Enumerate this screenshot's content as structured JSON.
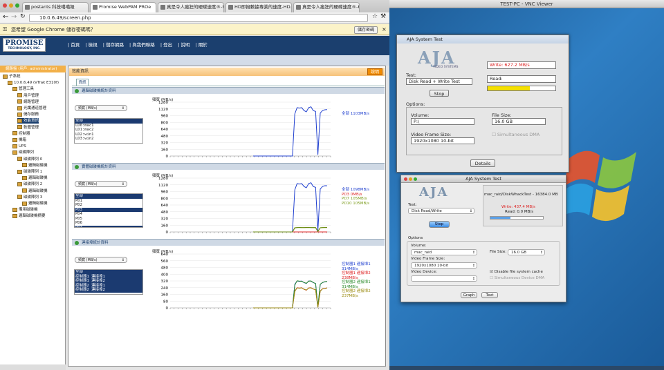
{
  "vnc": {
    "title": "TEST-PC - VNC Viewer"
  },
  "browser": {
    "tabs": [
      "postants 科技噶噶報",
      "Promise WebPAM PROe",
      "真是令人瘋狂的硬碟速度®-Pos",
      "HD即撥數據專業的速度-HD.Club",
      "真是令人瘋狂的硬碟速度®-HD"
    ],
    "url": "10.0.6.49/screen.php",
    "infobar_text": "您希望 Google Chrome 儲存密碼嗎？",
    "infobar_button": "儲存密碼"
  },
  "promise": {
    "logo": "PROMISE",
    "logo_sub": "TECHNOLOGY, INC.",
    "menu": [
      "| 首頁",
      "| 檢視",
      "| 儲存網路",
      "| 與我們聯絡",
      "| 登出",
      "| 說明",
      "| 關於"
    ],
    "sidebar_top": "網路盤 (用戶: administrator)",
    "tree": [
      {
        "label": "子系統",
        "indent": 0
      },
      {
        "label": "10.0.6.49 (VTrak E310f)",
        "indent": 1
      },
      {
        "label": "管理工具",
        "indent": 2
      },
      {
        "label": "用戶管理",
        "indent": 3
      },
      {
        "label": "網路管理",
        "indent": 3
      },
      {
        "label": "光纖通道管理",
        "indent": 3
      },
      {
        "label": "儲存服務",
        "indent": 3
      },
      {
        "label": "效能資訊",
        "indent": 3,
        "selected": true
      },
      {
        "label": "軟體管理",
        "indent": 3
      },
      {
        "label": "控制器",
        "indent": 2
      },
      {
        "label": "機箱",
        "indent": 2
      },
      {
        "label": "UPS",
        "indent": 2
      },
      {
        "label": "磁碟陣列",
        "indent": 2
      },
      {
        "label": "磁碟陣列 0",
        "indent": 3
      },
      {
        "label": "邏輯磁碟機",
        "indent": 4
      },
      {
        "label": "磁碟陣列 1",
        "indent": 3
      },
      {
        "label": "邏輯磁碟機",
        "indent": 4
      },
      {
        "label": "磁碟陣列 2",
        "indent": 3
      },
      {
        "label": "邏輯磁碟機",
        "indent": 4
      },
      {
        "label": "磁碟陣列 3",
        "indent": 3
      },
      {
        "label": "邏輯磁碟機",
        "indent": 4
      },
      {
        "label": "備用磁碟機",
        "indent": 2
      },
      {
        "label": "邏輯磁碟機摘要",
        "indent": 2
      }
    ],
    "page_title": "效能資訊",
    "help_button": "說明",
    "tab_info": "資訊",
    "sections": [
      {
        "title": "邏輯磁碟機統計資料",
        "dropdown": "頻寬 (MB/s)",
        "items": [
          {
            "t": "全部",
            "on": true
          },
          {
            "t": "LD0:mac1",
            "on": false
          },
          {
            "t": "LD1:mac2",
            "on": false
          },
          {
            "t": "LD2:win1",
            "on": false
          },
          {
            "t": "LD3:win2",
            "on": false
          }
        ],
        "chart_title": "頻寬 (MB/s)",
        "legend": [
          {
            "t": "全部 1103MB/s",
            "c": "#1f3fcf"
          }
        ]
      },
      {
        "title": "實體磁碟機統計資料",
        "dropdown": "頻寬 (MB/s)",
        "items": [
          {
            "t": "全部",
            "on": true
          },
          {
            "t": "PD1",
            "on": false
          },
          {
            "t": "PD2",
            "on": false
          },
          {
            "t": "PD3",
            "on": true
          },
          {
            "t": "PD4",
            "on": false
          },
          {
            "t": "PD5",
            "on": false
          },
          {
            "t": "PD6",
            "on": false
          },
          {
            "t": "PD7",
            "on": true
          }
        ],
        "chart_title": "頻寬 (MB/s)",
        "legend": [
          {
            "t": "全部 1098MB/s",
            "c": "#1f3fcf"
          },
          {
            "t": "PD3 0MB/s",
            "c": "#d22"
          },
          {
            "t": "PD7 105MB/s",
            "c": "#7a9a1a"
          },
          {
            "t": "PD10 105MB/s",
            "c": "#7a9a1a"
          }
        ]
      },
      {
        "title": "連接埠統計資料",
        "dropdown": "頻寬 (MB/s)",
        "items": [
          {
            "t": "全部",
            "on": true
          },
          {
            "t": "控制器1 連接埠1",
            "on": true
          },
          {
            "t": "控制器1 連接埠2",
            "on": true
          },
          {
            "t": "控制器2 連接埠1",
            "on": true
          },
          {
            "t": "控制器2 連接埠2",
            "on": true
          }
        ],
        "chart_title": "頻寬 (MB/s)",
        "legend": [
          {
            "t": "控制器1 連接埠1",
            "c": "#1f3fcf"
          },
          {
            "t": "314MB/s",
            "c": "#1f3fcf"
          },
          {
            "t": "控制器1 連接埠2",
            "c": "#d22"
          },
          {
            "t": "238MB/s",
            "c": "#d22"
          },
          {
            "t": "控制器2 連接埠1",
            "c": "#2a8a2a"
          },
          {
            "t": "314MB/s",
            "c": "#2a8a2a"
          },
          {
            "t": "控制器2 連接埠2",
            "c": "#9a8a10"
          },
          {
            "t": "237MB/s",
            "c": "#9a8a10"
          }
        ]
      }
    ]
  },
  "chart_data": [
    {
      "type": "line",
      "ylabel": "頻寬 (MB/s)",
      "ylim": [
        0,
        1280
      ],
      "yticks": [
        0,
        160,
        320,
        480,
        640,
        800,
        960,
        1120,
        1280
      ],
      "series": [
        {
          "name": "全部",
          "color": "#1f3fcf",
          "values": [
            0,
            0,
            0,
            0,
            0,
            0,
            0,
            0,
            0,
            0,
            0,
            0,
            0,
            0,
            0,
            0,
            0,
            0,
            1000,
            1150,
            1140,
            1150,
            1080,
            1050,
            1150,
            1170,
            1080,
            1060,
            30,
            1020,
            1080,
            1100,
            1103
          ]
        }
      ]
    },
    {
      "type": "line",
      "ylabel": "頻寬 (MB/s)",
      "ylim": [
        0,
        1280
      ],
      "yticks": [
        0,
        160,
        320,
        480,
        640,
        800,
        960,
        1120,
        1280
      ],
      "series": [
        {
          "name": "全部",
          "color": "#1f3fcf",
          "values": [
            0,
            0,
            0,
            0,
            0,
            0,
            0,
            0,
            0,
            0,
            0,
            0,
            0,
            0,
            0,
            0,
            0,
            0,
            1000,
            1150,
            1140,
            1150,
            1080,
            1050,
            1150,
            1170,
            1080,
            1060,
            30,
            1020,
            1080,
            1100,
            1098
          ]
        },
        {
          "name": "PD3",
          "color": "#d22",
          "values": [
            0,
            0,
            0,
            0,
            0,
            0,
            0,
            0,
            0,
            0,
            0,
            0,
            0,
            0,
            0,
            0,
            0,
            0,
            0,
            0,
            0,
            0,
            0,
            0,
            0,
            0,
            0,
            0,
            0,
            0,
            0,
            0,
            0
          ]
        },
        {
          "name": "PD7",
          "color": "#7a9a1a",
          "values": [
            0,
            0,
            0,
            0,
            0,
            0,
            0,
            0,
            0,
            0,
            0,
            0,
            0,
            0,
            0,
            0,
            0,
            0,
            100,
            105,
            105,
            104,
            105,
            106,
            105,
            105,
            104,
            105,
            10,
            100,
            105,
            105,
            105
          ]
        },
        {
          "name": "PD10",
          "color": "#6a8a10",
          "values": [
            0,
            0,
            0,
            0,
            0,
            0,
            0,
            0,
            0,
            0,
            0,
            0,
            0,
            0,
            0,
            0,
            0,
            0,
            95,
            104,
            106,
            105,
            103,
            105,
            106,
            104,
            105,
            104,
            8,
            98,
            104,
            105,
            105
          ]
        }
      ]
    },
    {
      "type": "line",
      "ylabel": "頻寬 (MB/s)",
      "ylim": [
        0,
        640
      ],
      "yticks": [
        0,
        80,
        160,
        240,
        320,
        400,
        480,
        560,
        640
      ],
      "series": [
        {
          "name": "控制器1 連接埠1",
          "color": "#1f3fcf",
          "values": [
            0,
            0,
            0,
            0,
            0,
            0,
            0,
            0,
            0,
            0,
            0,
            0,
            0,
            0,
            0,
            0,
            0,
            0,
            280,
            320,
            315,
            318,
            300,
            290,
            320,
            318,
            300,
            290,
            10,
            280,
            300,
            310,
            314
          ]
        },
        {
          "name": "控制器1 連接埠2",
          "color": "#d22",
          "values": [
            0,
            0,
            0,
            0,
            0,
            0,
            0,
            0,
            0,
            0,
            0,
            0,
            0,
            0,
            0,
            0,
            0,
            0,
            200,
            240,
            236,
            240,
            220,
            210,
            238,
            240,
            225,
            215,
            8,
            200,
            228,
            232,
            238
          ]
        },
        {
          "name": "控制器2 連接埠1",
          "color": "#2a8a2a",
          "values": [
            0,
            0,
            0,
            0,
            0,
            0,
            0,
            0,
            0,
            0,
            0,
            0,
            0,
            0,
            0,
            0,
            0,
            0,
            270,
            322,
            318,
            316,
            302,
            292,
            318,
            320,
            302,
            288,
            12,
            282,
            302,
            312,
            314
          ]
        },
        {
          "name": "控制器2 連接埠2",
          "color": "#9a8a10",
          "values": [
            0,
            0,
            0,
            0,
            0,
            0,
            0,
            0,
            0,
            0,
            0,
            0,
            0,
            0,
            0,
            0,
            0,
            0,
            195,
            238,
            234,
            238,
            222,
            212,
            236,
            238,
            224,
            214,
            6,
            198,
            226,
            230,
            237
          ]
        }
      ]
    }
  ],
  "aja1": {
    "title": "AJA System Test",
    "logo": "AJA",
    "logo_sub": "VIDEO SYSTEMS",
    "write": "Write: 627.2 MB/s",
    "read": "Read:",
    "progress": 0.62,
    "test_label": "Test:",
    "test_value": "Disk Read + Write Test",
    "stop": "Stop",
    "options": "Options:",
    "volume_label": "Volume:",
    "volume_value": "P:\\",
    "filesize_label": "File Size:",
    "filesize_value": "16.0 GB",
    "frame_label": "Video Frame Size:",
    "frame_value": "1920x1080 10-bit",
    "dma_label": "Simultaneous DMA",
    "details": "Details"
  },
  "aja2": {
    "title": "AJA System Test",
    "logo": "AJA",
    "status_path": "mac_raid/DiskWhackTest - 16384.0 MB",
    "write": "Write: 437.4 MB/s",
    "read": "Read: 0.0 MB/s",
    "progress": 0.38,
    "test_label": "Test:",
    "test_value": "Disk Read/Write",
    "stop": "Stop",
    "options": "Options",
    "volume_label": "Volume:",
    "volume_value": "mac_raid",
    "filesize_label": "File Size:",
    "filesize_value": "16.0 GB",
    "frame_label": "Video Frame Size:",
    "frame_value": "1920x1080 10-bit",
    "device_label": "Video Device:",
    "device_value": "",
    "cache_label": "Disable file system cache",
    "dma_label": "Simultaneous Device DMA",
    "graph": "Graph",
    "text": "Text"
  }
}
